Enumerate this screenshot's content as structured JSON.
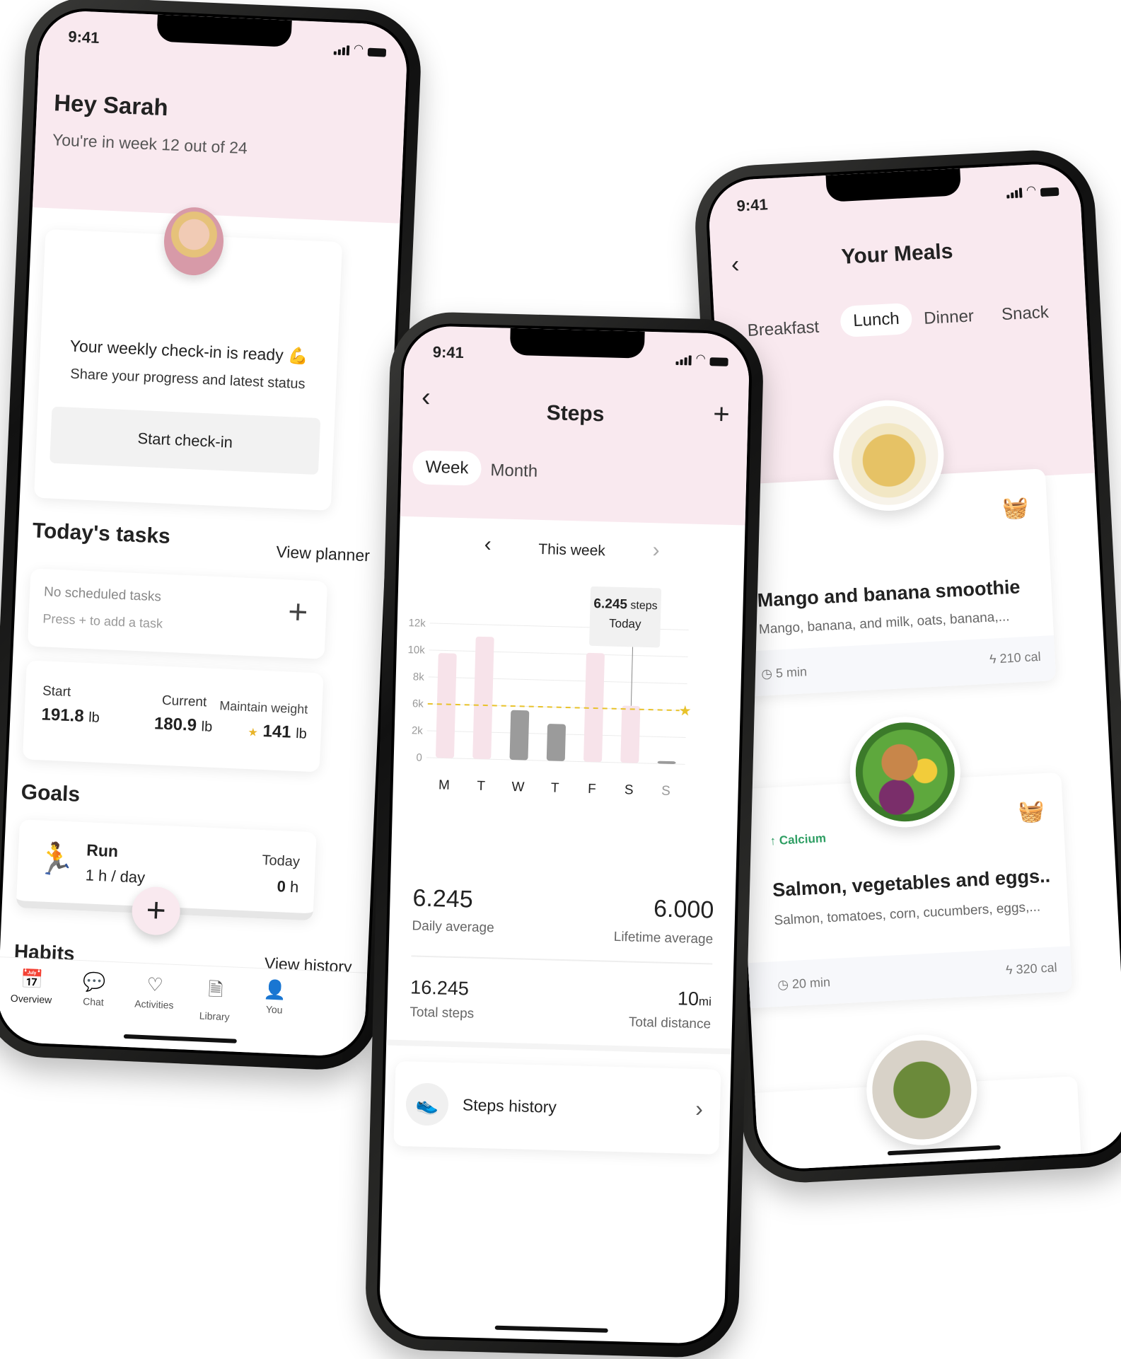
{
  "status": {
    "time": "9:41"
  },
  "overview": {
    "greeting": "Hey Sarah",
    "subtitle": "You're in week 12 out of 24",
    "checkin": {
      "title": "Your weekly check-in is ready 💪",
      "subtitle": "Share your progress and latest status",
      "button": "Start check-in"
    },
    "tasks": {
      "title": "Today's tasks",
      "link": "View planner",
      "empty_title": "No scheduled tasks",
      "empty_hint": "Press + to add a task"
    },
    "weight": {
      "start_label": "Start",
      "start_value": "191.8",
      "current_label": "Current",
      "current_value": "180.9",
      "goal_label": "Maintain weight",
      "goal_value": "141",
      "unit": "lb"
    },
    "goals": {
      "title": "Goals",
      "name": "Run",
      "target": "1 h / day",
      "today_label": "Today",
      "today_value": "0",
      "today_unit": "h"
    },
    "habits": {
      "title": "Habits",
      "link": "View history"
    },
    "tabs": [
      {
        "label": "Overview",
        "icon": "calendar-check-icon"
      },
      {
        "label": "Chat",
        "icon": "chat-icon"
      },
      {
        "label": "Activities",
        "icon": "heart-pulse-icon"
      },
      {
        "label": "Library",
        "icon": "document-icon"
      },
      {
        "label": "You",
        "icon": "user-icon"
      }
    ]
  },
  "steps": {
    "title": "Steps",
    "tabs": [
      "Week",
      "Month"
    ],
    "active_tab": "Week",
    "period": "This week",
    "tooltip": {
      "value": "6.245",
      "unit": "steps",
      "label": "Today"
    },
    "daily_average": "6.245",
    "daily_average_label": "Daily average",
    "lifetime_average": "6.000",
    "lifetime_average_label": "Lifetime average",
    "total_steps": "16.245",
    "total_steps_label": "Total steps",
    "total_distance": "10",
    "total_distance_unit": "mi",
    "total_distance_label": "Total distance",
    "history": "Steps history"
  },
  "chart_data": {
    "type": "bar",
    "categories": [
      "M",
      "T",
      "W",
      "T",
      "F",
      "S",
      "S"
    ],
    "values": [
      9800,
      11100,
      5400,
      3500,
      10100,
      6245,
      200
    ],
    "goal": 6000,
    "yticks": [
      "0",
      "2k",
      "6k",
      "8k",
      "10k",
      "12k"
    ],
    "ytick_values": [
      0,
      2000,
      6000,
      8000,
      10000,
      12000
    ],
    "colors": {
      "above_goal": "#f7e3ea",
      "below_goal": "#9b9b9b",
      "goal_line": "#e8c22a"
    },
    "grid": true
  },
  "meals": {
    "title": "Your Meals",
    "tabs": [
      "Breakfast",
      "Lunch",
      "Dinner",
      "Snack"
    ],
    "active_tab": "Lunch",
    "items": [
      {
        "name": "Mango and banana smoothie",
        "ingredients": "Mango, banana, and milk, oats, banana,...",
        "time": "5 min",
        "calories": "210 cal",
        "tag": ""
      },
      {
        "name": "Salmon, vegetables and eggs..",
        "ingredients": "Salmon, tomatoes, corn, cucumbers, eggs,...",
        "time": "20 min",
        "calories": "320 cal",
        "tag": "Calcium"
      }
    ],
    "tag_color": "#2e9e63"
  }
}
